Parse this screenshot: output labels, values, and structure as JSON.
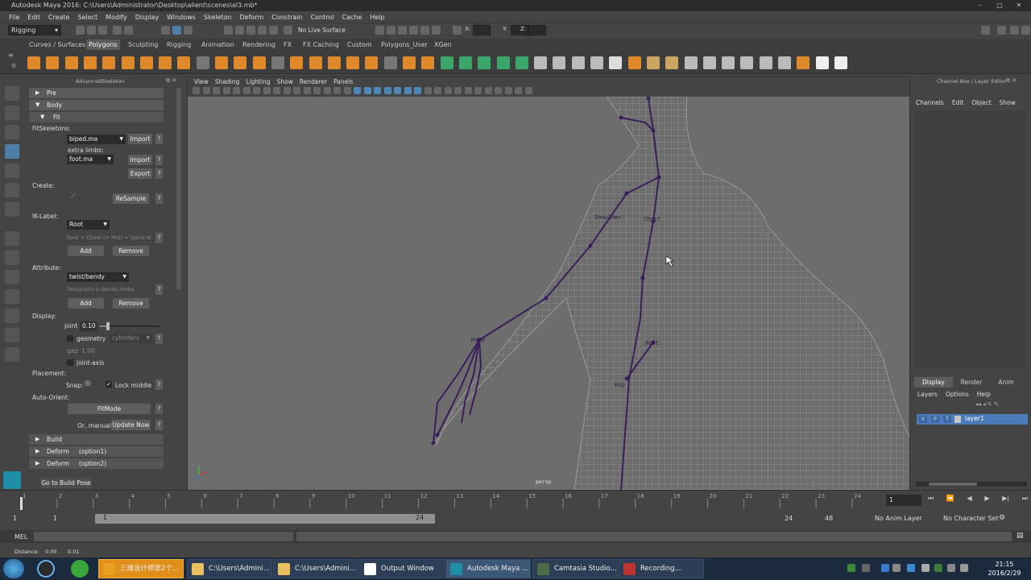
{
  "window": {
    "title": "Autodesk Maya 2016: C:\\Users\\Administrator\\Desktop\\alient\\scenes\\al3.mb*"
  },
  "menubar": [
    "File",
    "Edit",
    "Create",
    "Select",
    "Modify",
    "Display",
    "Windows",
    "Skeleton",
    "Deform",
    "Constrain",
    "Control",
    "Cache",
    "Help"
  ],
  "statusline": {
    "mode": "Rigging",
    "live_surface": "No Live Surface",
    "x_label": "X:",
    "y_label": "Y:",
    "z_label": "Z:"
  },
  "shelf_tabs": [
    "Curves / Surfaces",
    "Polygons",
    "Sculpting",
    "Rigging",
    "Animation",
    "Rendering",
    "FX",
    "FX Caching",
    "Custom",
    "Polygons_User",
    "XGen"
  ],
  "shelf_active_tab": "Polygons",
  "left_panel": {
    "title": "AdvancedSkeleton",
    "pre": "Pre",
    "body": "Body",
    "fit": "Fit",
    "fit_skeletons_label": "FitSkeletons:",
    "fit_skeleton_value": "biped.ma",
    "import_label": "Import",
    "extra_limbs_label": "extra limbs:",
    "extra_limbs_value": "foot.ma",
    "export_label": "Export",
    "create_label": "Create:",
    "resample_label": "ReSample",
    "iklabel_label": "IK-Label:",
    "iklabel_value": "Root",
    "iklabel_hint": "Root + Chest (+ Mid) = Spine IK",
    "add_label": "Add",
    "remove_label": "Remove",
    "attribute_label": "Attribute:",
    "attribute_value": "twist/bendy",
    "attribute_hint": "TwistJoints & Bendy-limbs",
    "display_label": "Display:",
    "joint_label": "joint",
    "joint_value": "0.10",
    "geometry_label": "geometry",
    "geometry_value": "cylinders",
    "gap_label": "gap",
    "gap_value": "1.00",
    "joint_axis_label": "joint-axis",
    "placement_label": "Placement:",
    "snap_label": "Snap:",
    "lock_middle_label": "Lock middle",
    "auto_orient_label": "Auto-Orient:",
    "fitmode_label": "FitMode",
    "or_manual_label": "Or, manual:",
    "update_now_label": "Update Now",
    "build_label": "Build",
    "deform1_label": "Deform",
    "deform1_option": "(option1)",
    "deform2_label": "Deform",
    "deform2_option": "(option2)",
    "go_to_build_pose": "Go to Build Pose",
    "joint_slider_fraction": 0.1
  },
  "viewport": {
    "menu": [
      "View",
      "Shading",
      "Lighting",
      "Show",
      "Renderer",
      "Panels"
    ],
    "camera_label": "persp",
    "joint_labels": [
      "Shoulder",
      "Chest",
      "Hand",
      "Root",
      "Hip"
    ]
  },
  "right_panel": {
    "title": "Channel Box / Layer Editor",
    "menu": [
      "Channels",
      "Edit",
      "Object",
      "Show"
    ],
    "bottom_tabs": [
      "Display",
      "Render",
      "Anim"
    ],
    "layer_menu": [
      "Layers",
      "Options",
      "Help"
    ],
    "layer_flags": [
      "V",
      "P",
      "T"
    ],
    "layer_name": "layer1"
  },
  "timeline": {
    "ticks": [
      "1",
      "2",
      "3",
      "4",
      "5",
      "6",
      "7",
      "8",
      "9",
      "10",
      "11",
      "12",
      "13",
      "14",
      "15",
      "16",
      "17",
      "18",
      "19",
      "20",
      "21",
      "22",
      "23",
      "24"
    ],
    "current_frame": "1"
  },
  "range": {
    "start": "1",
    "inner_start": "1",
    "slider_start": "1",
    "slider_end": "24",
    "end": "24",
    "outer_end": "48",
    "anim_layer": "No Anim Layer",
    "char_set": "No Character Set"
  },
  "mel": {
    "label": "MEL"
  },
  "helpline": {
    "label": "Distance:",
    "v1": "0.00",
    "v2": "0.01"
  },
  "taskbar": {
    "tasks": [
      "三维设计师第2个...",
      "C:\\Users\\Admini...",
      "C:\\Users\\Admini...",
      "Output Window",
      "Autodesk Maya ...",
      "Camtasia Studio...",
      "Recording..."
    ],
    "time": "21:15",
    "date": "2016/2/29"
  },
  "colors": {
    "joint": "#3a1f5c",
    "selected_layer": "#4a7bb8",
    "active_tab": "#5b5b5b"
  }
}
